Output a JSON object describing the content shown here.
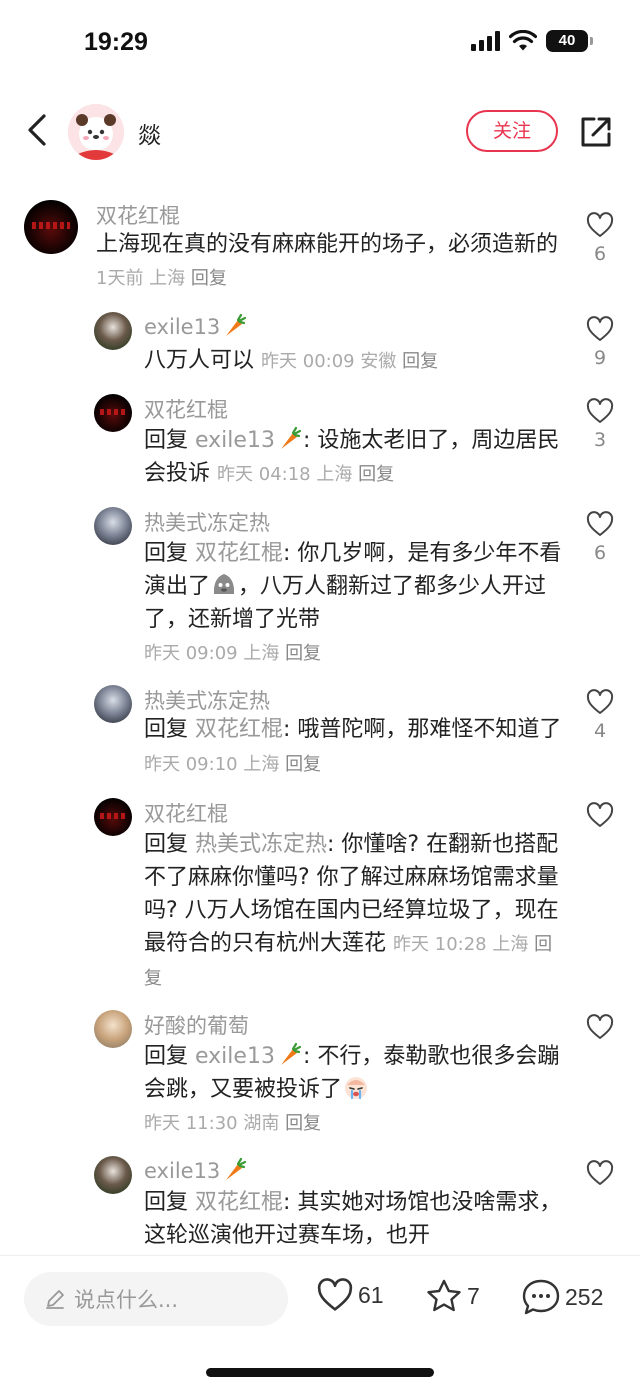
{
  "status_bar": {
    "time": "19:29",
    "battery": "40"
  },
  "header": {
    "user_name": "燚",
    "follow_label": "关注"
  },
  "comments": [
    {
      "author": "双花红棍",
      "text": "上海现在真的没有麻麻能开的场子，必须造新的",
      "meta": "1天前 上海",
      "reply_label": "回复",
      "likes": "6"
    },
    {
      "author": "exile13",
      "text": "八万人可以",
      "meta": "昨天 00:09 安徽",
      "reply_label": "回复",
      "likes": "9"
    },
    {
      "author": "双花红棍",
      "reply_prefix": "回复",
      "ref": "exile13",
      "text": ": 设施太老旧了，周边居民会投诉",
      "meta": "昨天 04:18 上海",
      "reply_label": "回复",
      "likes": "3"
    },
    {
      "author": "热美式冻定热",
      "reply_prefix": "回复",
      "ref": "双花红棍",
      "text_a": ": 你几岁啊，是有多少年不看演出了",
      "text_b": "，八万人翻新过了都多少人开过了，还新增了光带",
      "meta": "昨天 09:09 上海",
      "reply_label": "回复",
      "likes": "6"
    },
    {
      "author": "热美式冻定热",
      "reply_prefix": "回复",
      "ref": "双花红棍",
      "text": ": 哦普陀啊，那难怪不知道了",
      "meta": "昨天 09:10 上海",
      "reply_label": "回复",
      "likes": "4"
    },
    {
      "author": "双花红棍",
      "reply_prefix": "回复",
      "ref": "热美式冻定热",
      "text": ": 你懂啥? 在翻新也搭配不了麻麻你懂吗? 你了解过麻麻场馆需求量吗? 八万人场馆在国内已经算垃圾了，现在最符合的只有杭州大莲花",
      "meta": "昨天 10:28 上海",
      "reply_label": "回复",
      "likes": ""
    },
    {
      "author": "好酸的葡萄",
      "reply_prefix": "回复",
      "ref": "exile13",
      "text": ": 不行，泰勒歌也很多会蹦会跳，又要被投诉了",
      "meta": "昨天 11:30 湖南",
      "reply_label": "回复",
      "likes": ""
    },
    {
      "author": "exile13",
      "reply_prefix": "回复",
      "ref": "双花红棍",
      "text": ": 其实她对场馆也没啥需求，这轮巡演他开过赛车场，也开",
      "likes": ""
    }
  ],
  "bottom_bar": {
    "input_placeholder": "说点什么...",
    "likes": "61",
    "favorites": "7",
    "comments": "252"
  },
  "colors": {
    "accent": "#e8344e",
    "muted": "#999999"
  }
}
